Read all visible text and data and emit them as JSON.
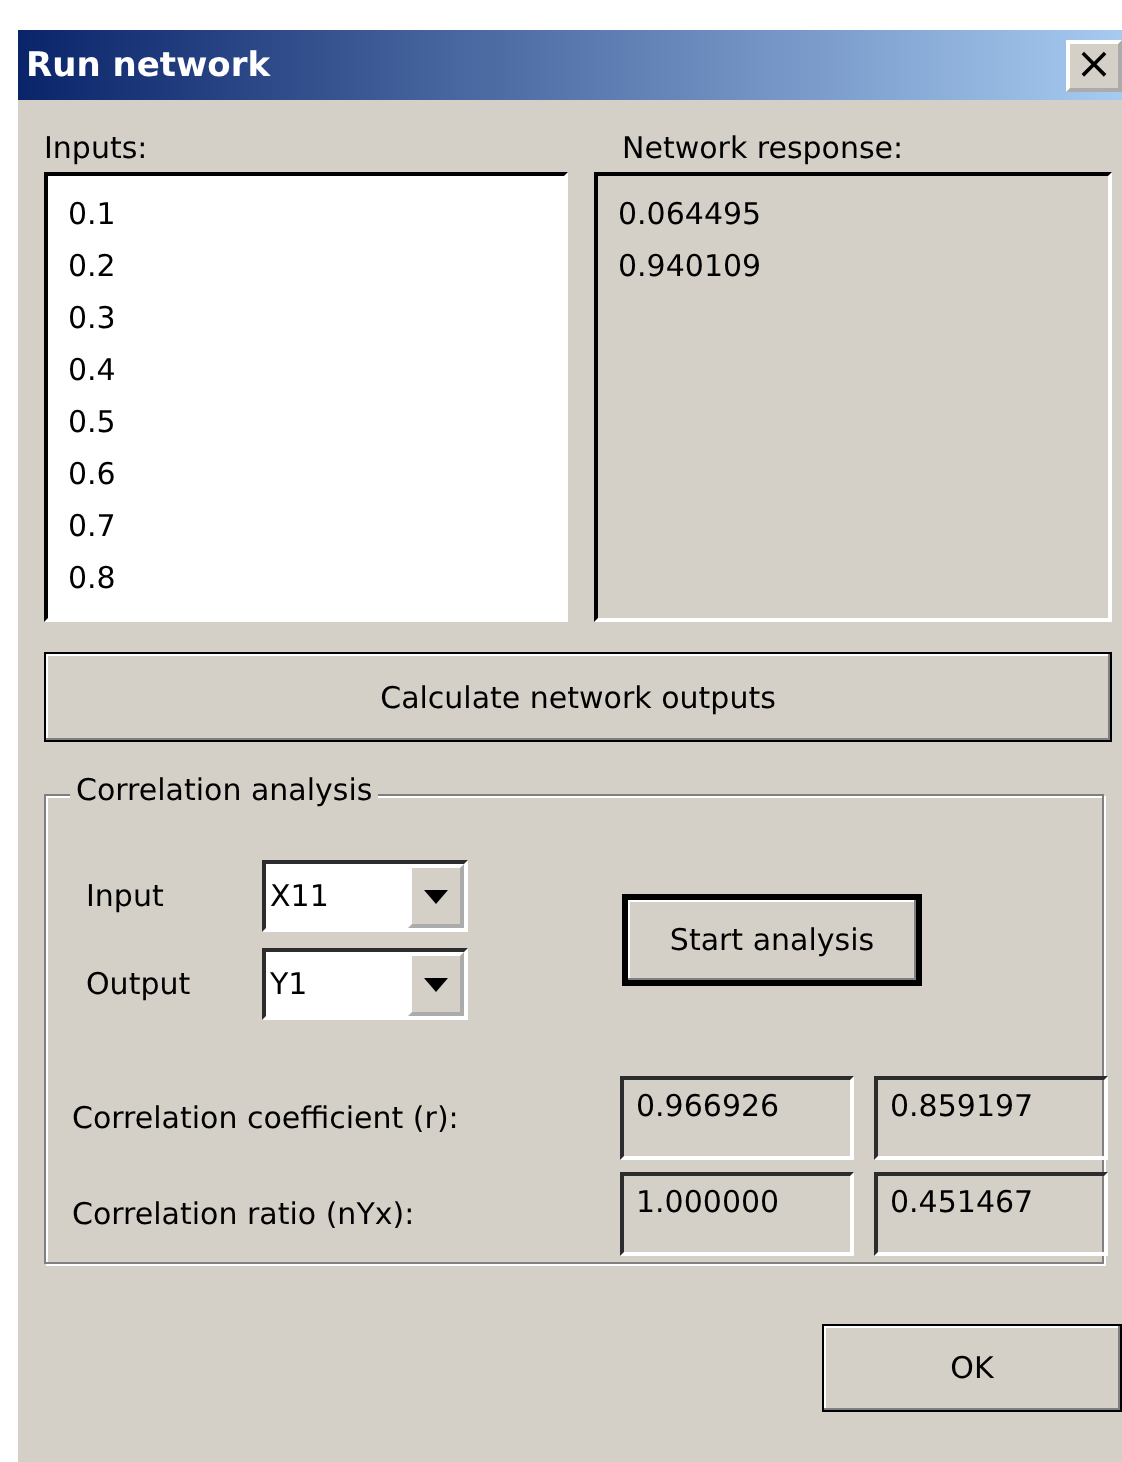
{
  "window": {
    "title": "Run network",
    "close": "×"
  },
  "inputs": {
    "label": "Inputs:",
    "items": [
      "0.1",
      "0.2",
      "0.3",
      "0.4",
      "0.5",
      "0.6",
      "0.7",
      "0.8"
    ]
  },
  "response": {
    "label": "Network response:",
    "items": [
      "0.064495",
      "0.940109"
    ]
  },
  "calculate_button": {
    "label": "Calculate network outputs",
    "default": false
  },
  "correlation": {
    "title": "Correlation analysis",
    "selectors": [
      {
        "label": "Input",
        "value": "X11"
      },
      {
        "label": "Output",
        "value": "Y1"
      }
    ],
    "start_button": {
      "label": "Start analysis",
      "default": true
    },
    "results": [
      {
        "label": "Correlation coefficient (r):",
        "values": [
          "0.966926",
          "0.859197"
        ]
      },
      {
        "label": "Correlation ratio (nYx):",
        "values": [
          "1.000000",
          "0.451467"
        ]
      }
    ]
  },
  "ok_button": {
    "label": "OK",
    "default": false
  }
}
